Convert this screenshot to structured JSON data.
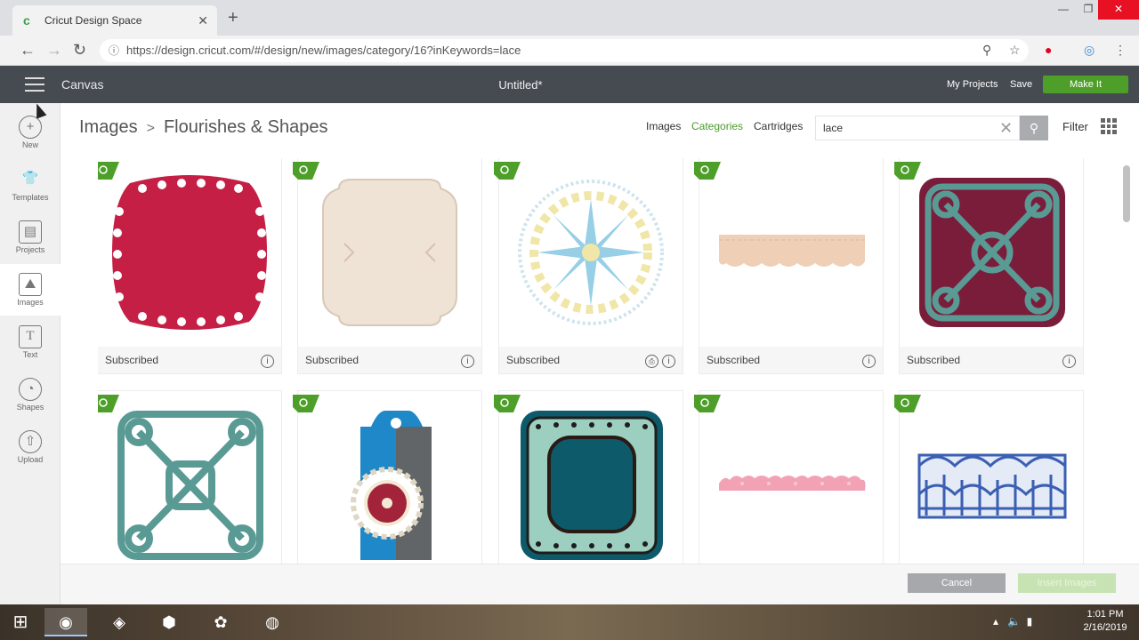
{
  "browser": {
    "tab_title": "Cricut Design Space",
    "url": "https://design.cricut.com/#/design/new/images/category/16?inKeywords=lace",
    "icons": [
      "back-icon",
      "forward-icon",
      "reload-icon",
      "lock-icon",
      "zoom-icon",
      "star-icon",
      "pinterest-icon",
      "extension-icon",
      "menu-icon"
    ]
  },
  "header": {
    "menu_label": "Canvas",
    "title": "Untitled*",
    "my_projects": "My Projects",
    "save": "Save",
    "make_it": "Make It"
  },
  "sidebar": {
    "items": [
      {
        "label": "New",
        "icon": "new-icon"
      },
      {
        "label": "Templates",
        "icon": "shirt-icon"
      },
      {
        "label": "Projects",
        "icon": "projects-icon"
      },
      {
        "label": "Images",
        "icon": "images-icon"
      },
      {
        "label": "Text",
        "icon": "text-icon"
      },
      {
        "label": "Shapes",
        "icon": "shapes-icon"
      },
      {
        "label": "Upload",
        "icon": "upload-icon"
      }
    ]
  },
  "breadcrumb": {
    "root": "Images",
    "sep": ">",
    "current": "Flourishes & Shapes"
  },
  "filters": {
    "images": "Images",
    "categories": "Categories",
    "cartridges": "Cartridges",
    "filter": "Filter"
  },
  "search": {
    "value": "lace",
    "placeholder": ""
  },
  "cards": [
    {
      "status": "Subscribed",
      "color": "#c51f45",
      "shape": "scallop-square"
    },
    {
      "status": "Subscribed",
      "color": "#efe3d6",
      "shape": "cream-label"
    },
    {
      "status": "Subscribed",
      "color": "#7cc4e0",
      "shape": "doily"
    },
    {
      "status": "Subscribed",
      "color": "#efcfb5",
      "shape": "lace-border"
    },
    {
      "status": "Subscribed",
      "color": "#7a1d3a",
      "shape": "ornate-square"
    },
    {
      "status": "",
      "color": "#5a9a94",
      "shape": "teal-frame"
    },
    {
      "status": "",
      "color": "#1f88c8",
      "shape": "tag"
    },
    {
      "status": "",
      "color": "#0d5a6a",
      "shape": "scallop-frame"
    },
    {
      "status": "",
      "color": "#f3a2b6",
      "shape": "pink-border"
    },
    {
      "status": "",
      "color": "#3a5fb3",
      "shape": "blue-lace"
    }
  ],
  "footer": {
    "cancel": "Cancel",
    "insert": "Insert Images"
  },
  "taskbar": {
    "time": "1:01 PM",
    "date": "2/16/2019"
  }
}
